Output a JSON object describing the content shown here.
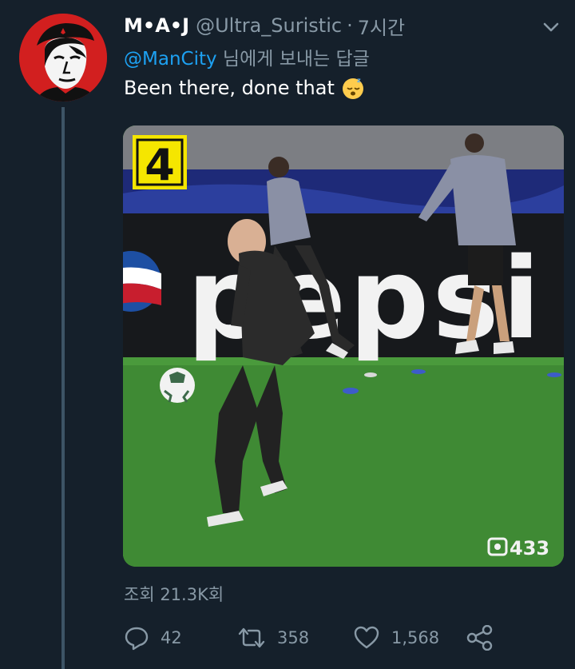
{
  "tweet": {
    "display_name": "M•A•J",
    "handle": "@Ultra_Suristic",
    "separator": "·",
    "time": "7시간",
    "reply_mention": "@ManCity",
    "reply_suffix": " 님에게 보내는 답글",
    "text": "Been there, done that",
    "emoji": "sleeping-face",
    "views": "조회 21.3K회"
  },
  "media": {
    "badge_number": "4",
    "watermark": "433",
    "ad_board_text": "pepsi",
    "pitch_color": "#3f8a34"
  },
  "actions": {
    "reply_count": "42",
    "retweet_count": "358",
    "like_count": "1,568"
  },
  "colors": {
    "background": "#15202b",
    "secondary_text": "#8899a6",
    "link": "#1da1f2",
    "avatar_bg": "#d21f1f"
  }
}
